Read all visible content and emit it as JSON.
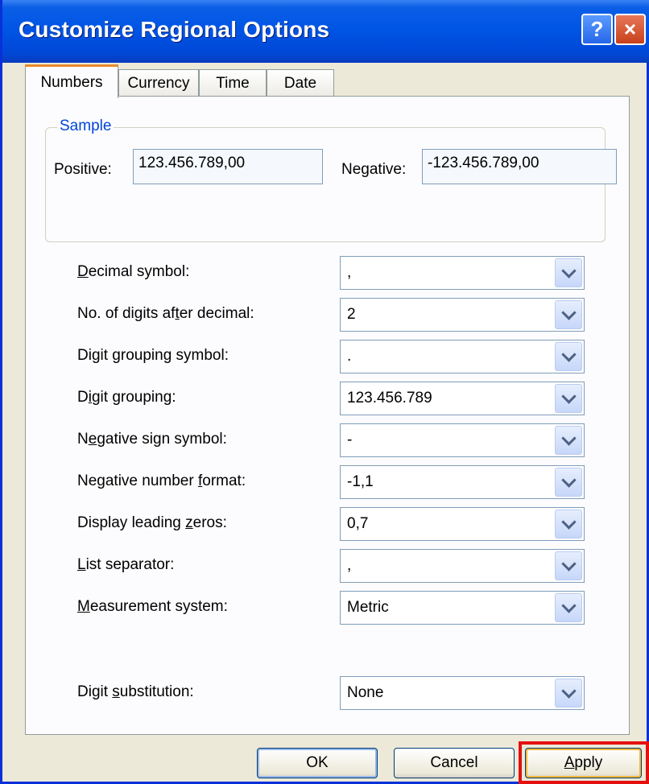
{
  "window": {
    "title": "Customize Regional Options",
    "help_glyph": "?",
    "close_glyph": "×"
  },
  "tabs": [
    "Numbers",
    "Currency",
    "Time",
    "Date"
  ],
  "sample": {
    "legend": "Sample",
    "positive_label": "Positive:",
    "positive_value": "123.456.789,00",
    "negative_label": "Negative:",
    "negative_value": "-123.456.789,00"
  },
  "rows": [
    {
      "pre": "",
      "mn": "D",
      "post": "ecimal symbol:",
      "value": ","
    },
    {
      "pre": "No. of digits af",
      "mn": "t",
      "post": "er decimal:",
      "value": "2"
    },
    {
      "pre": "Digit ",
      "mn": "g",
      "post": "rouping symbol:",
      "value": "."
    },
    {
      "pre": "D",
      "mn": "i",
      "post": "git grouping:",
      "value": "123.456.789"
    },
    {
      "pre": "N",
      "mn": "e",
      "post": "gative sign symbol:",
      "value": "-"
    },
    {
      "pre": "Negative number ",
      "mn": "f",
      "post": "ormat:",
      "value": "-1,1"
    },
    {
      "pre": "Display leading ",
      "mn": "z",
      "post": "eros:",
      "value": "0,7"
    },
    {
      "pre": "",
      "mn": "L",
      "post": "ist separator:",
      "value": ","
    },
    {
      "pre": "",
      "mn": "M",
      "post": "easurement system:",
      "value": "Metric"
    },
    {
      "pre": "Digit ",
      "mn": "s",
      "post": "ubstitution:",
      "value": "None"
    }
  ],
  "buttons": {
    "ok": "OK",
    "cancel": "Cancel",
    "apply_mn": "A",
    "apply_rest": "pply"
  },
  "colors": {
    "title_bar": "#0055e5",
    "active_tab_accent": "#e68b2c",
    "highlight": "#e41010"
  }
}
